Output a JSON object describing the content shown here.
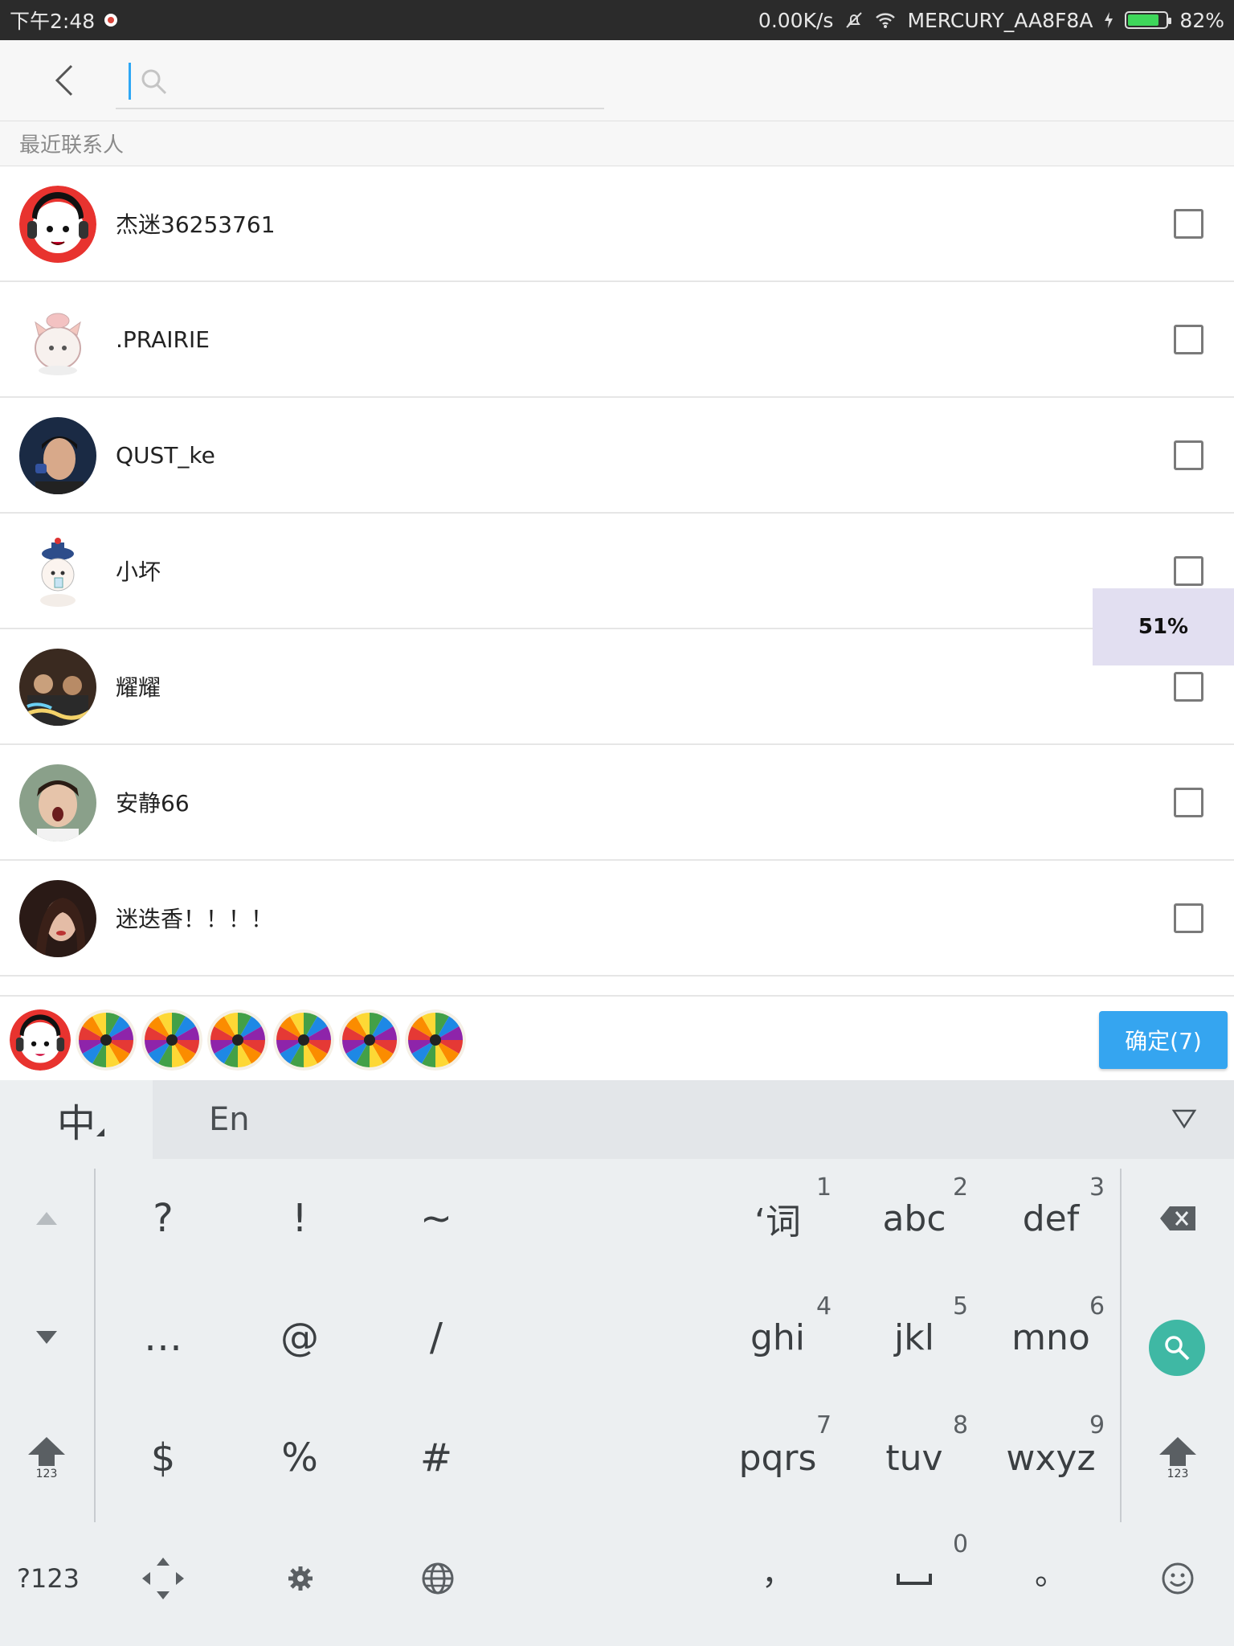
{
  "status_bar": {
    "time": "下午2:48",
    "net_speed": "0.00K/s",
    "wifi_name": "MERCURY_AA8F8A",
    "battery": "82%",
    "battery_level": 0.82
  },
  "search": {
    "placeholder": ""
  },
  "section": {
    "label": "最近联系人"
  },
  "contacts": [
    {
      "name": "杰迷36253761",
      "checked": false
    },
    {
      "name": ".PRAIRIE",
      "checked": false
    },
    {
      "name": "QUST_ke",
      "checked": false
    },
    {
      "name": "小坏",
      "checked": false
    },
    {
      "name": "耀耀",
      "checked": false
    },
    {
      "name": "安静66",
      "checked": false
    },
    {
      "name": "迷迭香！！！！",
      "checked": false
    }
  ],
  "progress_toast": "51%",
  "selected": {
    "count": 7,
    "confirm_label": "确定(7)"
  },
  "keyboard": {
    "lang_zh": "中",
    "lang_en": "En",
    "symbols": [
      "?",
      "!",
      "~",
      "…",
      "@",
      "/",
      "$",
      "%",
      "#"
    ],
    "t9": [
      {
        "letters": "‘词",
        "num": "1"
      },
      {
        "letters": "abc",
        "num": "2"
      },
      {
        "letters": "def",
        "num": "3"
      },
      {
        "letters": "ghi",
        "num": "4"
      },
      {
        "letters": "jkl",
        "num": "5"
      },
      {
        "letters": "mno",
        "num": "6"
      },
      {
        "letters": "pqrs",
        "num": "7"
      },
      {
        "letters": "tuv",
        "num": "8"
      },
      {
        "letters": "wxyz",
        "num": "9"
      }
    ],
    "shift_label": "123",
    "mode_key": "?123",
    "comma": "，",
    "space_num": "0",
    "period": "。"
  },
  "colors": {
    "accent": "#35a5f0",
    "search_key": "#3fb8a4",
    "status_bar": "#2b2b2b",
    "toast": "#e2dff1"
  }
}
